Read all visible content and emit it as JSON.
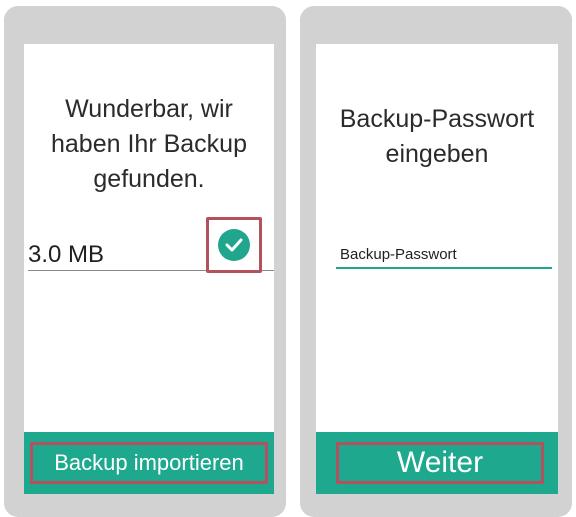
{
  "left_screen": {
    "title_lines": [
      "Wunderbar, wir",
      "haben Ihr Backup",
      "gefunden."
    ],
    "backup_size": "3.0  MB",
    "check_icon": "checkmark-circle-icon",
    "import_button_label": "Backup importieren"
  },
  "right_screen": {
    "title_lines": [
      "Backup-Passwort",
      "eingeben"
    ],
    "password_placeholder": "Backup-Passwort",
    "next_button_label": "Weiter"
  },
  "colors": {
    "accent": "#1ea88e",
    "highlight_border": "#b3525e",
    "phone_frame": "#d2d2d2"
  }
}
